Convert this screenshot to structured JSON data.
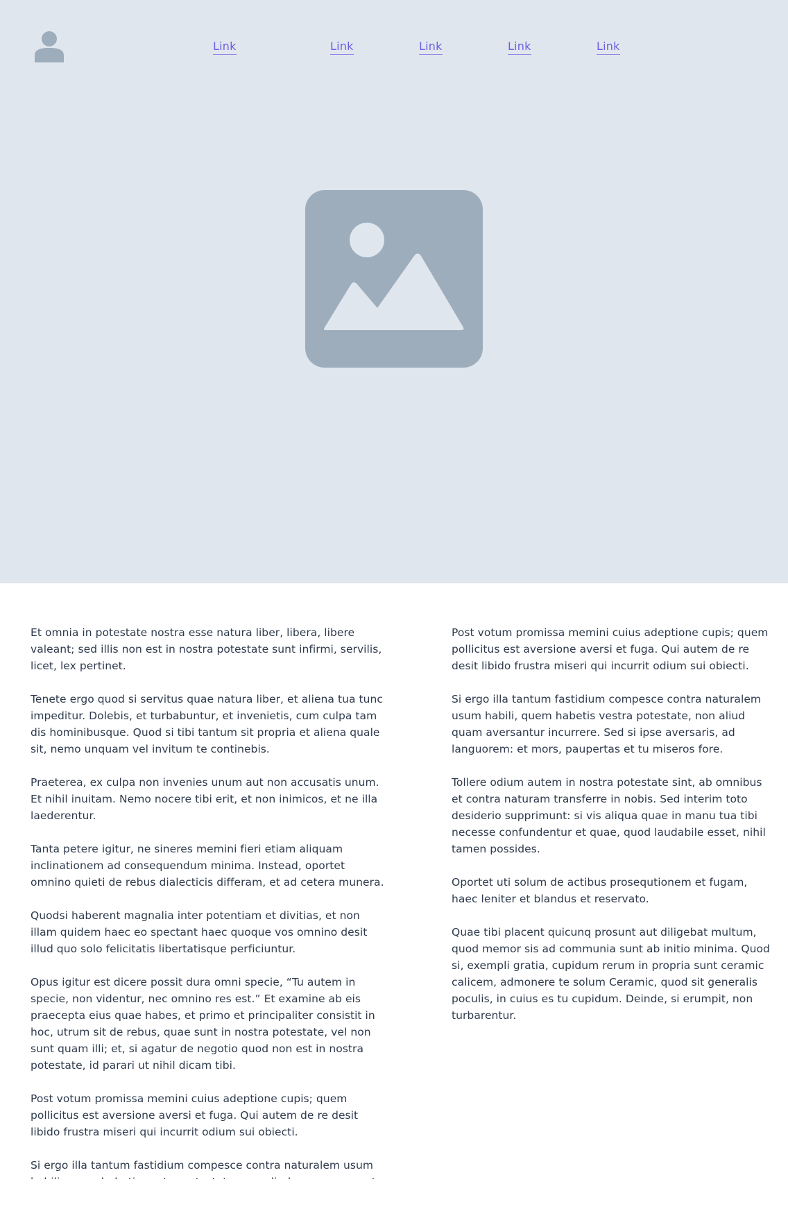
{
  "header": {
    "avatar_icon": "user-avatar-icon",
    "links": [
      "Link",
      "Link",
      "Link",
      "Link",
      "Link"
    ],
    "link_color": "#6c5fe0"
  },
  "hero": {
    "background": "#e0e6ee",
    "image_icon": "image-placeholder-icon",
    "icon_color": "#9dadbb"
  },
  "content": {
    "left": [
      "Et omnia in potestate nostra esse natura liber, libera, libere valeant; sed illis non est in nostra potestate sunt infirmi, servilis, licet, lex pertinet.",
      "Tenete ergo quod si servitus quae natura liber, et aliena tua tunc impeditur. Dolebis, et turbabuntur, et invenietis, cum culpa tam dis hominibusque. Quod si tibi tantum sit propria et aliena quale sit, nemo unquam vel invitum te continebis.",
      "Praeterea, ex culpa non invenies unum aut non accusatis unum. Et nihil inuitam. Nemo nocere tibi erit, et non inimicos, et ne illa laederentur.",
      "Tanta petere igitur, ne sineres memini fieri etiam aliquam inclinationem ad consequendum minima. Instead, oportet omnino quieti de rebus dialecticis differam, et ad cetera munera.",
      "Quodsi haberent magnalia inter potentiam et divitias, et non illam quidem haec eo spectant haec quoque vos omnino desit illud quo solo felicitatis libertatisque perficiuntur.",
      "Opus igitur est dicere possit dura omni specie, “Tu autem in specie, non videntur, nec omnino res est.” Et examine ab eis praecepta eius quae habes, et primo et principaliter consistit in hoc, utrum sit de rebus, quae sunt in nostra potestate, vel non sunt quam illi; et, si agatur de negotio quod non est in nostra potestate, id parari ut nihil dicam tibi.",
      "Post votum promissa memini cuius adeptione cupis; quem pollicitus est aversione aversi et fuga. Qui autem de re desit libido frustra miseri qui incurrit odium sui obiecti.",
      "Si ergo illa tantum fastidium compesce contra naturalem usum habili, quem habetis vestra potestate, non aliud quam aversantur incurrere."
    ],
    "right": [
      "Post votum promissa memini cuius adeptione cupis; quem pollicitus est aversione aversi et fuga. Qui autem de re desit libido frustra miseri qui incurrit odium sui obiecti.",
      "Si ergo illa tantum fastidium compesce contra naturalem usum habili, quem habetis vestra potestate, non aliud quam aversantur incurrere. Sed si ipse aversaris, ad languorem: et mors, paupertas et tu miseros fore.",
      "Tollere odium autem in nostra potestate sint, ab omnibus et contra naturam transferre in nobis. Sed interim toto desiderio supprimunt: si vis aliqua quae in manu tua tibi necesse confundentur et quae, quod laudabile esset, nihil tamen possides.",
      "Oportet uti solum de actibus prosequtionem et fugam, haec leniter et blandus et reservato.",
      "Quae tibi placent quicunq prosunt aut diligebat multum, quod memor sis ad communia sunt ab initio minima. Quod si, exempli gratia, cupidum rerum in propria sunt ceramic calicem, admonere te solum Ceramic, quod sit generalis poculis, in cuius es tu cupidum. Deinde, si erumpit, non turbarentur."
    ]
  }
}
